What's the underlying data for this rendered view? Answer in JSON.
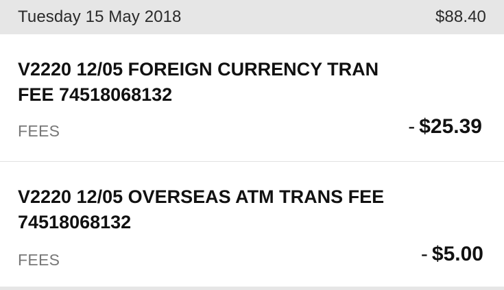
{
  "group": {
    "date": "Tuesday 15 May 2018",
    "total": "$88.40"
  },
  "transactions": [
    {
      "description": "V2220 12/05 FOREIGN CURRENCY TRAN\nFEE 74518068132",
      "category": "FEES",
      "sign": "-",
      "amount": "$25.39"
    },
    {
      "description": "V2220 12/05 OVERSEAS ATM TRANS FEE\n74518068132",
      "category": "FEES",
      "sign": "-",
      "amount": "$5.00"
    }
  ],
  "colors": {
    "header_bg": "#e6e6e6",
    "text_primary": "#111111",
    "text_secondary": "#777777",
    "divider": "#e2e2e2"
  }
}
